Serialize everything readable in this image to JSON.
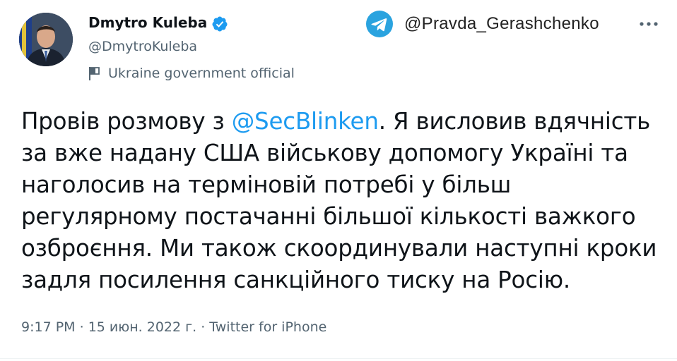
{
  "author": {
    "name": "Dmytro Kuleba",
    "handle": "@DmytroKuleba",
    "label": "Ukraine government official"
  },
  "source": {
    "handle": "@Pravda_Gerashchenko"
  },
  "tweet": {
    "text_before": "Провів розмову з ",
    "mention": "@SecBlinken",
    "text_after": ". Я висловив вдячність за вже надану США військову допомогу Україні та наголосив на терміновій потребі у більш регулярному постачанні більшої кількості важкого озброєння. Ми також скоординували наступні кроки задля посилення санкційного тиску на Росію."
  },
  "meta": {
    "time": "9:17 PM",
    "date": "15 июн. 2022 г.",
    "client": "Twitter for iPhone",
    "separator": " · "
  },
  "colors": {
    "accent": "#1d9bf0",
    "secondary_text": "#536471",
    "telegram": "#2aa3df"
  }
}
